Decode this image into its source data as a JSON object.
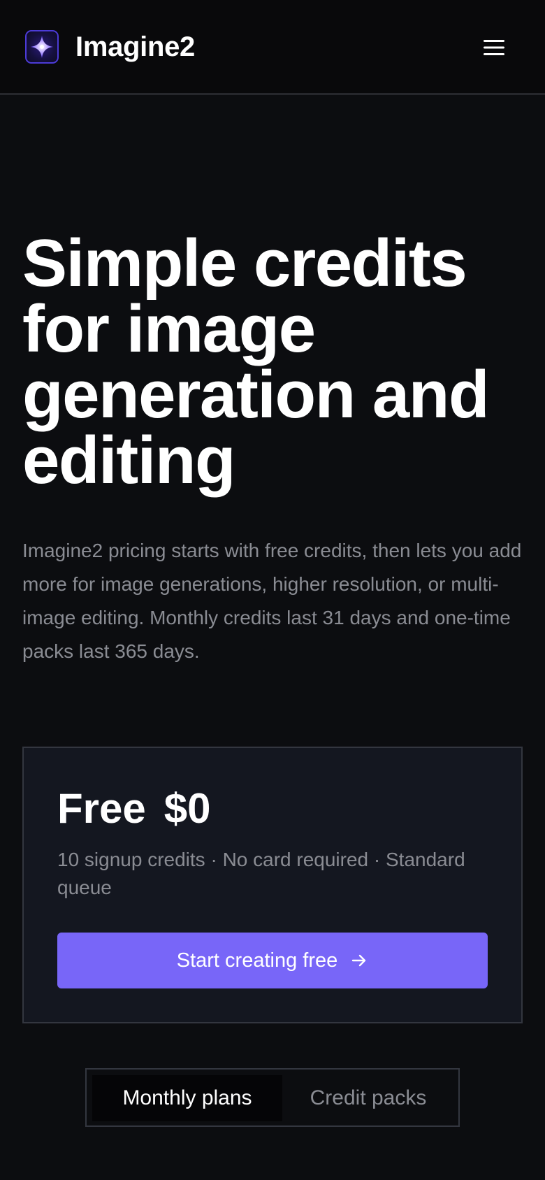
{
  "header": {
    "brand": "Imagine2",
    "logo_icon": "sparkle-icon",
    "menu_icon": "hamburger-menu-icon"
  },
  "hero": {
    "title": "Simple credits for image generation and editing",
    "description": "Imagine2 pricing starts with free credits, then lets you add more for image generations, higher resolution, or multi-image editing. Monthly credits last 31 days and one-time packs last 365 days."
  },
  "free_plan": {
    "name": "Free",
    "price": "$0",
    "features": "10 signup credits · No card required · Standard queue",
    "cta_label": "Start creating free",
    "cta_icon": "arrow-right-icon"
  },
  "plan_toggle": {
    "tabs": [
      {
        "label": "Monthly plans",
        "active": true
      },
      {
        "label": "Credit packs",
        "active": false
      }
    ]
  },
  "colors": {
    "background": "#0c0d10",
    "header_background": "#09090b",
    "card_background": "#141720",
    "accent": "#7866f8",
    "muted_text": "#8a8c93",
    "border": "#33363f"
  }
}
